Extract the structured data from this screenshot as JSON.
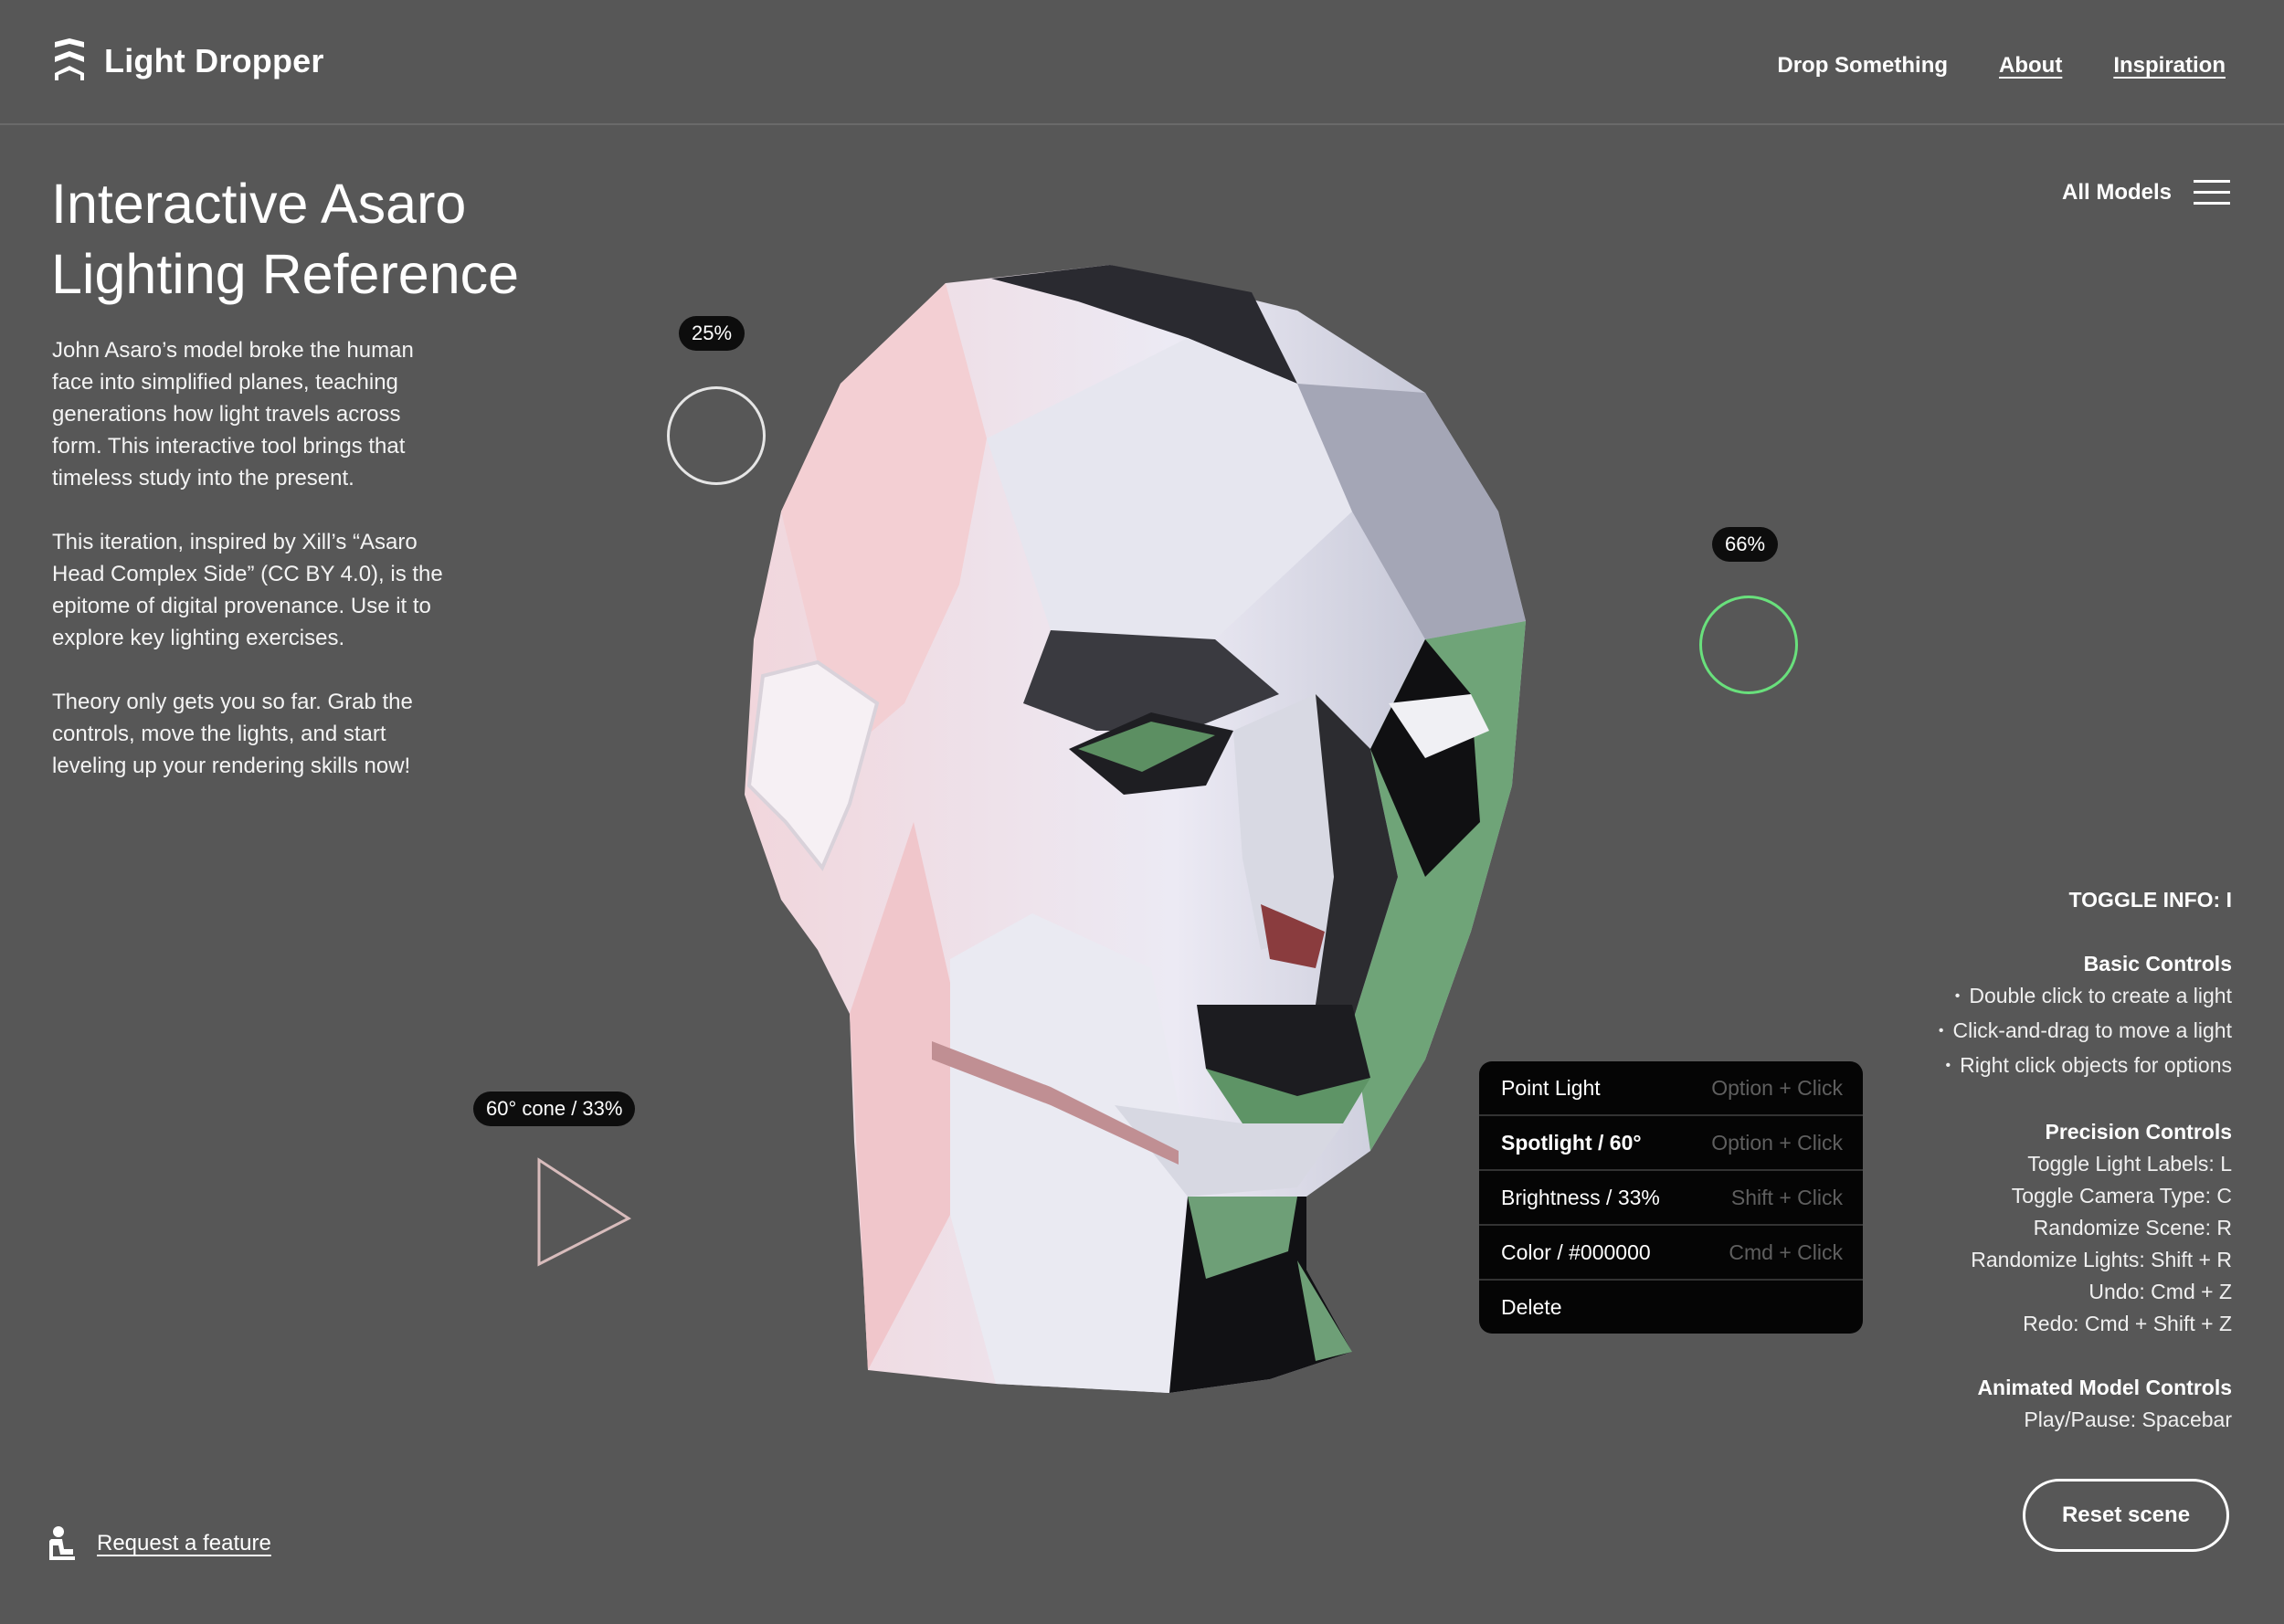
{
  "header": {
    "brand": "Light Dropper",
    "nav": [
      "Drop Something",
      "About",
      "Inspiration"
    ]
  },
  "page": {
    "title_line1": "Interactive Asaro",
    "title_line2": "Lighting Reference",
    "paragraphs": [
      "John Asaro’s model broke the human face into simplified planes, teaching generations how light travels across form. This interactive tool brings that timeless study into the present.",
      "This iteration, inspired by Xill’s “Asaro Head Complex Side” (CC BY 4.0), is the epitome of digital provenance. Use it to explore key lighting exercises.",
      "Theory only gets you so far. Grab the controls, move the lights, and start leveling up your rendering skills now!"
    ],
    "all_models": "All Models"
  },
  "lights": [
    {
      "label": "25%",
      "kind": "point",
      "color": "#e6e6e6"
    },
    {
      "label": "66%",
      "kind": "point",
      "color": "#69e07c"
    },
    {
      "label": "60° cone / 33%",
      "kind": "spotlight",
      "color": "#d8bcbc"
    }
  ],
  "context_menu": {
    "items": [
      {
        "label": "Point Light",
        "shortcut": "Option + Click"
      },
      {
        "label": "Spotlight / 60°",
        "shortcut": "Option + Click",
        "active": true
      },
      {
        "label": "Brightness / 33%",
        "shortcut": "Shift + Click"
      },
      {
        "label": "Color / #000000",
        "shortcut": "Cmd + Click"
      },
      {
        "label": "Delete",
        "shortcut": ""
      }
    ]
  },
  "info": {
    "toggle": "TOGGLE INFO: I",
    "basic_title": "Basic Controls",
    "basic": [
      "Double click to create a light",
      "Click-and-drag to move a light",
      "Right click objects for options"
    ],
    "precision_title": "Precision Controls",
    "precision": [
      "Toggle Light Labels: L",
      "Toggle Camera Type: C",
      "Randomize Scene: R",
      "Randomize Lights: Shift + R",
      "Undo: Cmd + Z",
      "Redo: Cmd + Shift + Z"
    ],
    "animated_title": "Animated Model Controls",
    "animated": [
      "Play/Pause: Spacebar"
    ]
  },
  "footer": {
    "reset": "Reset scene",
    "request": "Request a feature"
  },
  "colors": {
    "background": "#575757",
    "menu_bg": "#050505",
    "green_light": "#69e07c"
  }
}
